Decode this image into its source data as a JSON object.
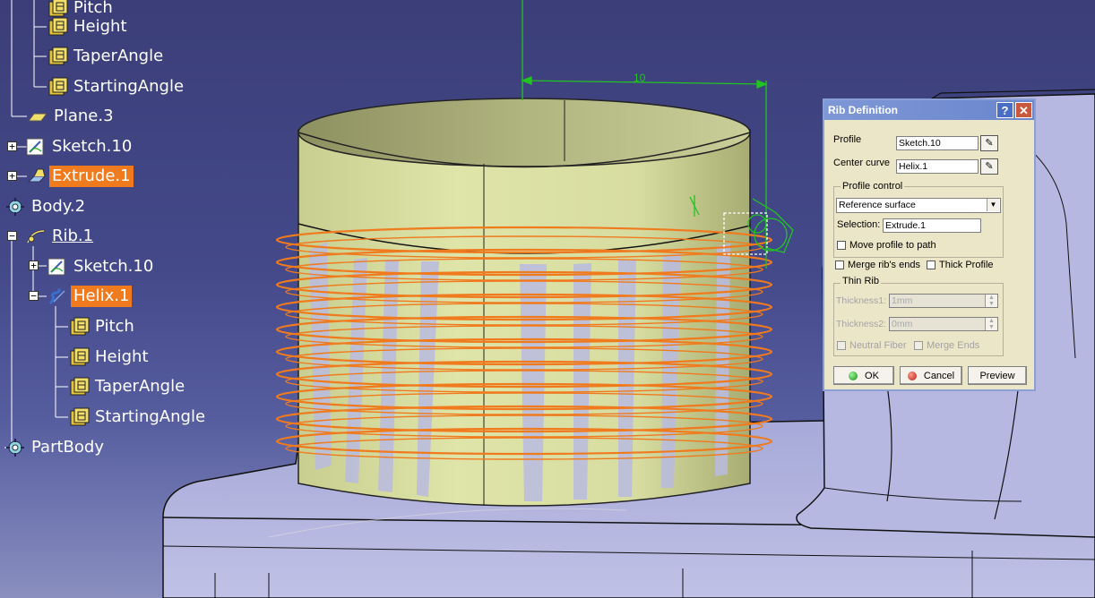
{
  "viewport": {
    "dimension_value": "10",
    "colors": {
      "background_top": "#3b3e78",
      "cylinder": "#d7dd9e",
      "helix": "#f07a1e",
      "table": "#b9badf",
      "sketch_green": "#22c422"
    }
  },
  "tree": {
    "items": [
      {
        "label": "Pitch",
        "icon": "parameter-icon"
      },
      {
        "label": "Height",
        "icon": "parameter-icon"
      },
      {
        "label": "TaperAngle",
        "icon": "parameter-icon"
      },
      {
        "label": "StartingAngle",
        "icon": "parameter-icon"
      },
      {
        "label": "Plane.3",
        "icon": "plane-icon"
      },
      {
        "label": "Sketch.10",
        "icon": "sketch-icon"
      },
      {
        "label": "Extrude.1",
        "icon": "extrude-icon",
        "selected": true
      },
      {
        "label": "Body.2",
        "icon": "body-icon"
      },
      {
        "label": "Rib.1",
        "icon": "rib-icon"
      },
      {
        "label": "Sketch.10",
        "icon": "sketch-icon"
      },
      {
        "label": "Helix.1",
        "icon": "helix-icon",
        "selected": true
      },
      {
        "label": "Pitch",
        "icon": "parameter-icon"
      },
      {
        "label": "Height",
        "icon": "parameter-icon"
      },
      {
        "label": "TaperAngle",
        "icon": "parameter-icon"
      },
      {
        "label": "StartingAngle",
        "icon": "parameter-icon"
      },
      {
        "label": "PartBody",
        "icon": "body-icon"
      }
    ]
  },
  "dialog": {
    "title": "Rib Definition",
    "help_label": "?",
    "close_label": "✕",
    "profile_label": "Profile",
    "profile_value": "Sketch.10",
    "center_curve_label": "Center curve",
    "center_curve_value": "Helix.1",
    "profile_control_label": "Profile control",
    "profile_control_value": "Reference surface",
    "selection_label": "Selection:",
    "selection_value": "Extrude.1",
    "move_profile_label": "Move profile to path",
    "merge_ends_label": "Merge rib's ends",
    "thick_profile_label": "Thick Profile",
    "thin_rib_label": "Thin Rib",
    "thickness1_label": "Thickness1:",
    "thickness1_value": "1mm",
    "thickness2_label": "Thickness2:",
    "thickness2_value": "0mm",
    "neutral_fiber_label": "Neutral Fiber",
    "merge_ends2_label": "Merge Ends",
    "ok_label": "OK",
    "cancel_label": "Cancel",
    "preview_label": "Preview"
  }
}
